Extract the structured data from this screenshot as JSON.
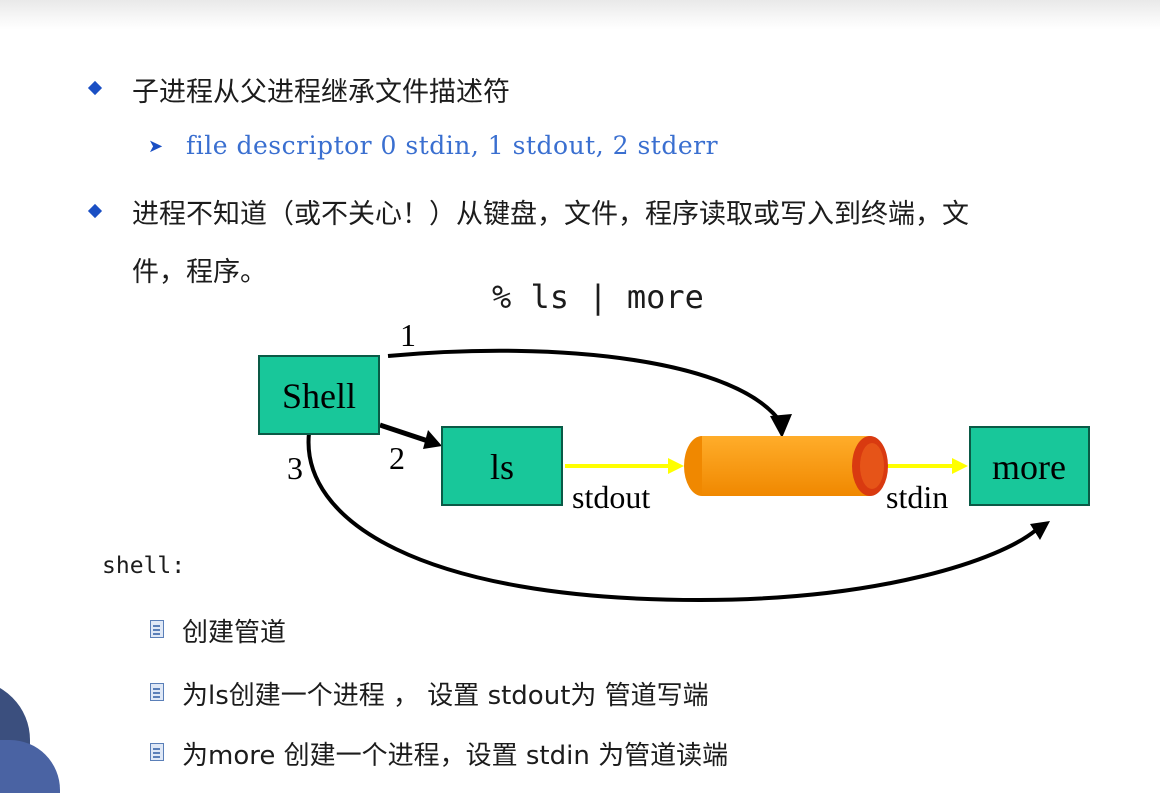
{
  "bullets": [
    {
      "text": "子进程从父进程继承文件描述符",
      "sub": "file descriptor 0 stdin, 1 stdout, 2 stderr"
    },
    {
      "line1": "进程不知道（或不关心！）从键盘，文件，程序读取或写入到终端，文",
      "line2": "件，程序。"
    }
  ],
  "diagram": {
    "command": "% ls | more",
    "boxes": {
      "shell": "Shell",
      "ls": "ls",
      "more": "more"
    },
    "labels": {
      "stdout": "stdout",
      "stdin": "stdin"
    },
    "steps": [
      "1",
      "2",
      "3"
    ],
    "colors": {
      "box": "#18c79a",
      "pipe": "#ff9900",
      "pipe_end": "#d93a10",
      "flow": "#ffff00"
    }
  },
  "shell_section": {
    "label": "shell:",
    "items": [
      "创建管道",
      "为ls创建一个进程 ， 设置 stdout为 管道写端",
      "为more 创建一个进程，设置 stdin 为管道读端"
    ]
  }
}
